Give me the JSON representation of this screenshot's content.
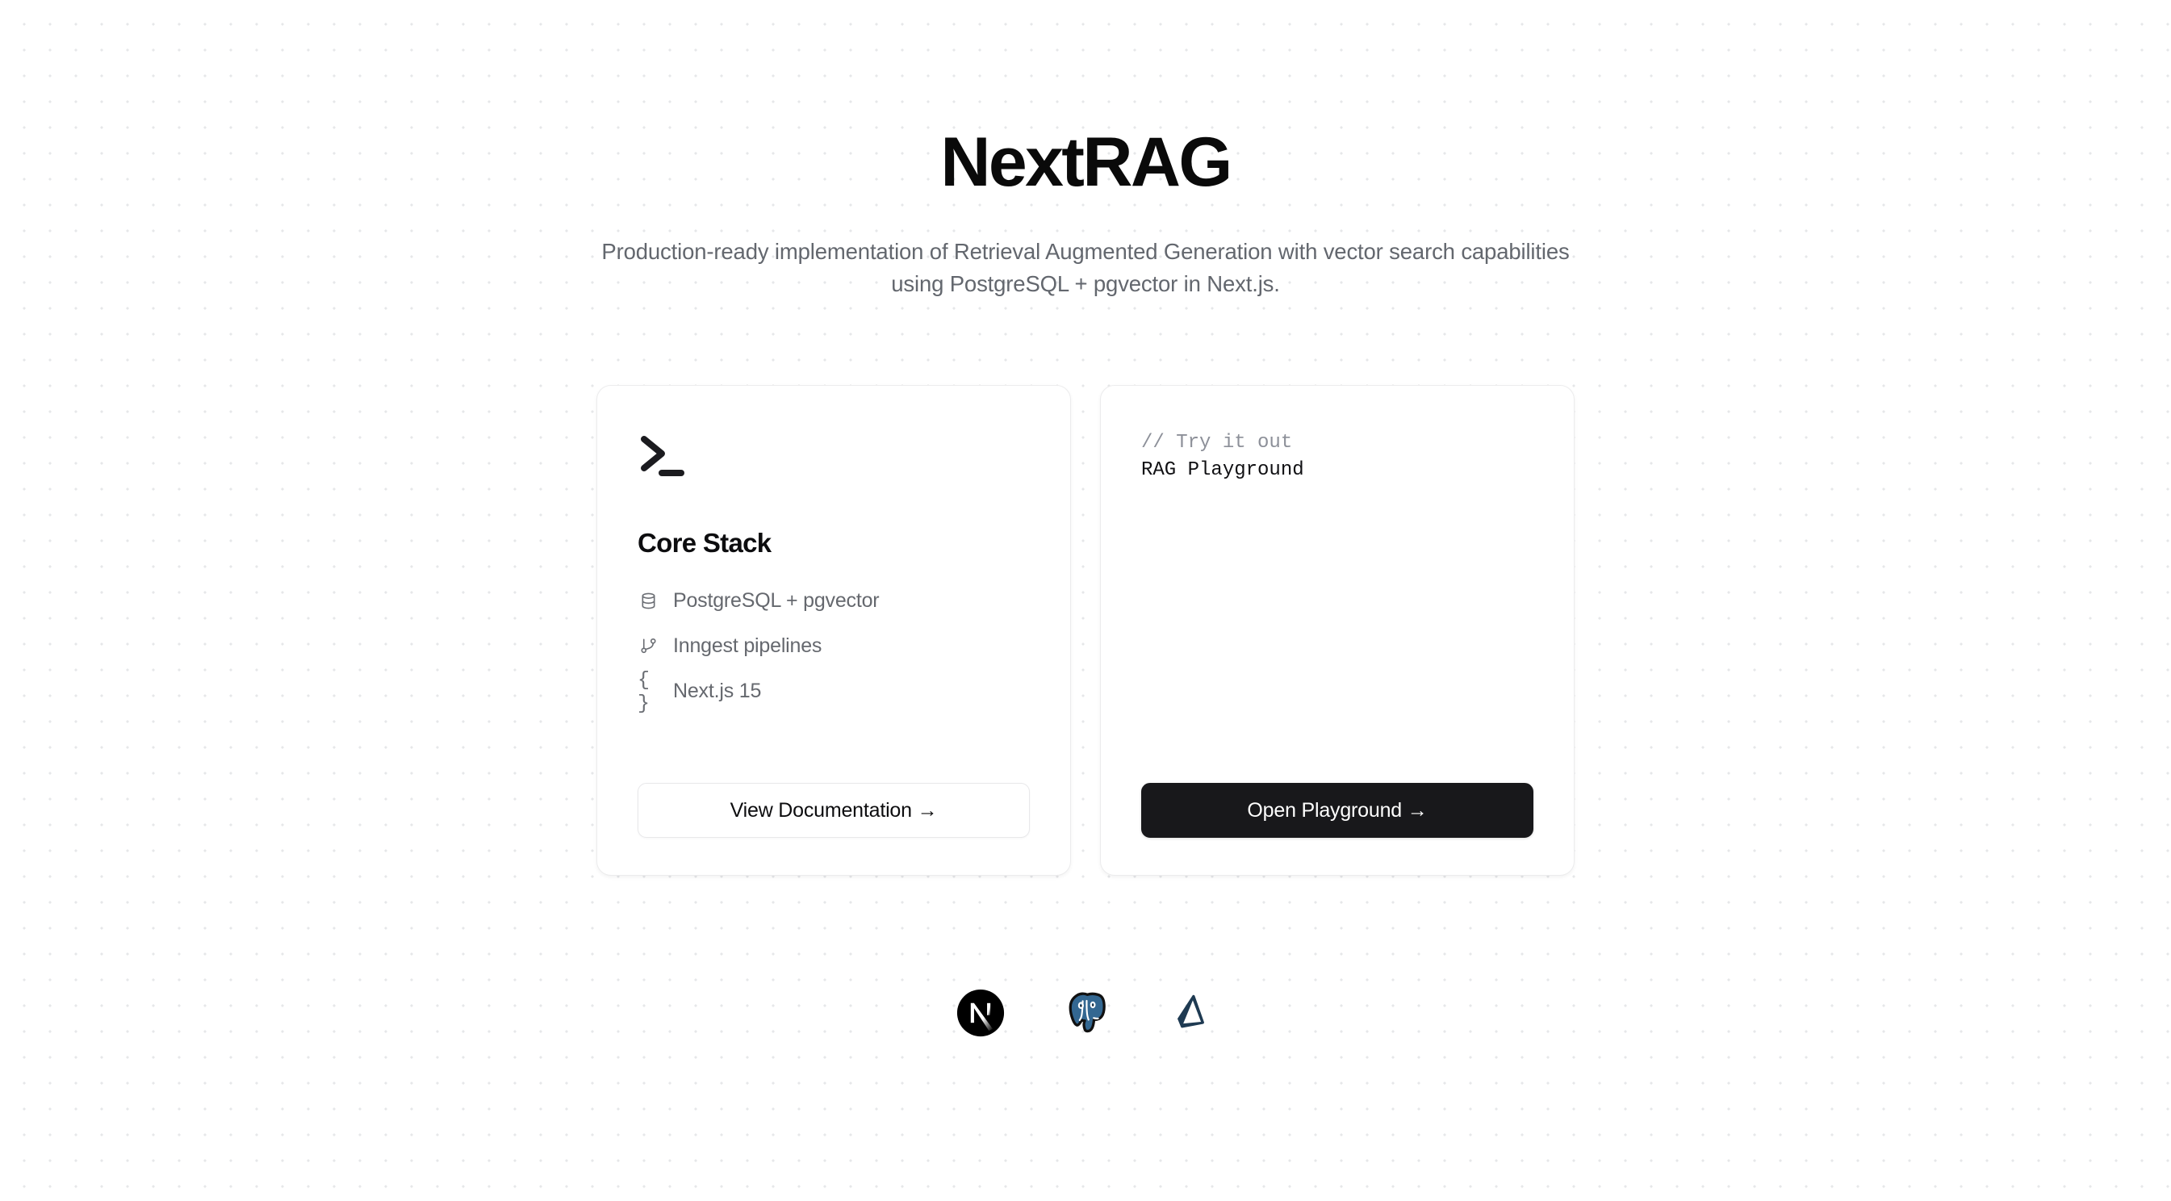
{
  "hero": {
    "title": "NextRAG",
    "subtitle": "Production-ready implementation of Retrieval Augmented Generation with vector search capabilities using PostgreSQL + pgvector in Next.js."
  },
  "cards": {
    "core_stack": {
      "icon": "terminal-prompt-icon",
      "heading": "Core Stack",
      "items": [
        {
          "icon": "database-icon",
          "label": "PostgreSQL + pgvector"
        },
        {
          "icon": "git-branch-icon",
          "label": "Inngest pipelines"
        },
        {
          "icon": "curly-braces-icon",
          "glyph": "{ }",
          "label": "Next.js 15"
        }
      ],
      "button": "View Documentation →"
    },
    "playground": {
      "comment": "// Try it out",
      "code": "RAG Playground",
      "button": "Open Playground →"
    }
  },
  "logos": [
    {
      "name": "nextjs-logo",
      "label": "Next.js"
    },
    {
      "name": "postgresql-logo",
      "label": "PostgreSQL"
    },
    {
      "name": "prisma-logo",
      "label": "Prisma"
    }
  ],
  "colors": {
    "text_primary": "#0a0a0a",
    "text_muted": "#63676e",
    "card_border": "#ececed",
    "button_dark": "#18181b",
    "dot_grid": "#e6e7e9",
    "postgres_blue": "#336791",
    "prisma_navy": "#1e3a52"
  }
}
